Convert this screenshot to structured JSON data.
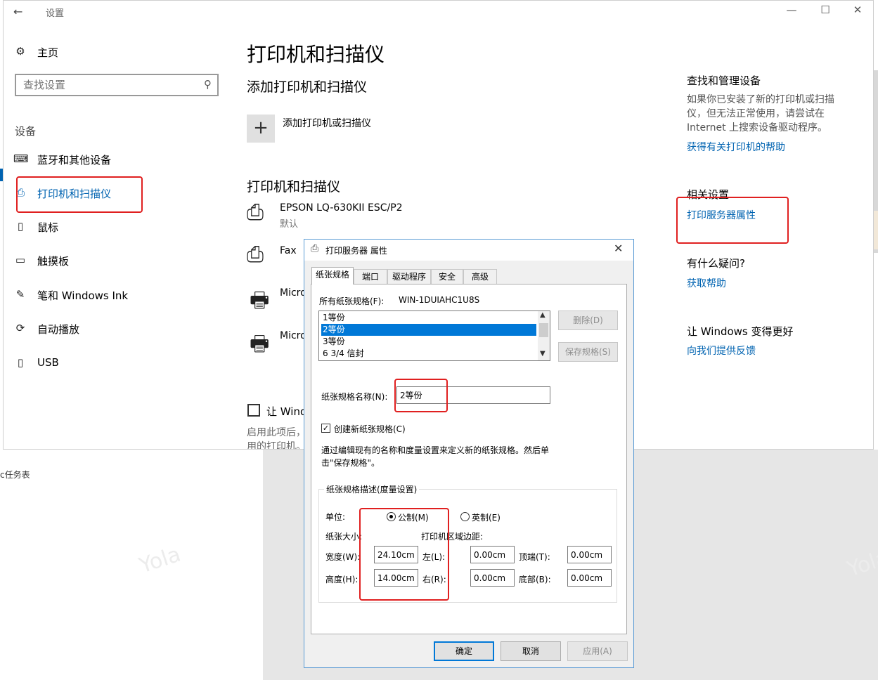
{
  "window": {
    "title": "设置",
    "back_glyph": "←",
    "minimize_glyph": "—",
    "maximize_glyph": "☐",
    "close_glyph": "✕"
  },
  "sidebar": {
    "home_label": "主页",
    "search_placeholder": "查找设置",
    "section_label": "设备",
    "items": [
      {
        "label": "蓝牙和其他设备",
        "icon": "bluetooth-devices-icon",
        "glyph": "⌨"
      },
      {
        "label": "打印机和扫描仪",
        "icon": "printer-icon",
        "glyph": "⎙",
        "active": true
      },
      {
        "label": "鼠标",
        "icon": "mouse-icon",
        "glyph": "▯"
      },
      {
        "label": "触摸板",
        "icon": "touchpad-icon",
        "glyph": "▭"
      },
      {
        "label": "笔和 Windows Ink",
        "icon": "pen-icon",
        "glyph": "✎"
      },
      {
        "label": "自动播放",
        "icon": "autoplay-icon",
        "glyph": "⟳"
      },
      {
        "label": "USB",
        "icon": "usb-icon",
        "glyph": "▯"
      }
    ]
  },
  "main": {
    "title": "打印机和扫描仪",
    "add_section_title": "添加打印机和扫描仪",
    "add_button_glyph": "+",
    "add_label": "添加打印机或扫描仪",
    "printers_section_title": "打印机和扫描仪",
    "printers": [
      {
        "name": "EPSON LQ-630KII ESC/P2",
        "status": "默认"
      },
      {
        "name": "Fax",
        "status": ""
      },
      {
        "name": "Micro",
        "status": ""
      },
      {
        "name": "Micro",
        "status": ""
      }
    ],
    "default_checkbox_label": "让 Wind",
    "default_desc_1": "启用此项后，",
    "default_desc_2": "用的打印机。"
  },
  "right": {
    "find_title": "查找和管理设备",
    "find_text_1": "如果你已安装了新的打印机或扫描",
    "find_text_2": "仪，但无法正常使用，请尝试在",
    "find_text_3": "Internet 上搜索设备驱动程序。",
    "find_link": "获得有关打印机的帮助",
    "related_title": "相关设置",
    "related_link": "打印服务器属性",
    "question_title": "有什么疑问?",
    "question_link": "获取帮助",
    "improve_title": "让 Windows 变得更好",
    "improve_link": "向我们提供反馈"
  },
  "desktop": {
    "taskbar_text": "c任务表",
    "watermark_text": "Yola"
  },
  "dialog": {
    "title": "打印服务器 属性",
    "tabs": [
      "纸张规格",
      "端口",
      "驱动程序",
      "安全",
      "高级"
    ],
    "all_forms_label": "所有纸张规格(F):",
    "server_name": "WIN-1DUIAHC1U8S",
    "forms": [
      "1等份",
      "2等份",
      "3等份",
      "6 3/4 信封"
    ],
    "selected_form_index": 1,
    "delete_button": "删除(D)",
    "save_button": "保存规格(S)",
    "form_name_label": "纸张规格名称(N):",
    "form_name_value": "2等份",
    "create_checkbox_label": "创建新纸张规格(C)",
    "create_checked": true,
    "desc_1": "通过编辑现有的名称和度量设置来定义新的纸张规格。然后单",
    "desc_2": "击\"保存规格\"。",
    "group_title": "纸张规格描述(度量设置)",
    "units_label": "单位:",
    "metric_label": "公制(M)",
    "english_label": "英制(E)",
    "paper_size_label": "纸张大小:",
    "margins_label": "打印机区域边距:",
    "width_label": "宽度(W):",
    "width_value": "24.10cm",
    "height_label": "高度(H):",
    "height_value": "14.00cm",
    "left_label": "左(L):",
    "left_value": "0.00cm",
    "right_label": "右(R):",
    "right_value": "0.00cm",
    "top_label": "顶端(T):",
    "top_value": "0.00cm",
    "bottom_label": "底部(B):",
    "bottom_value": "0.00cm",
    "ok_button": "确定",
    "cancel_button": "取消",
    "apply_button": "应用(A)",
    "close_glyph": "✕"
  },
  "colors": {
    "accent": "#0063b1",
    "highlight_box": "#e02020",
    "selection": "#0078d7"
  }
}
